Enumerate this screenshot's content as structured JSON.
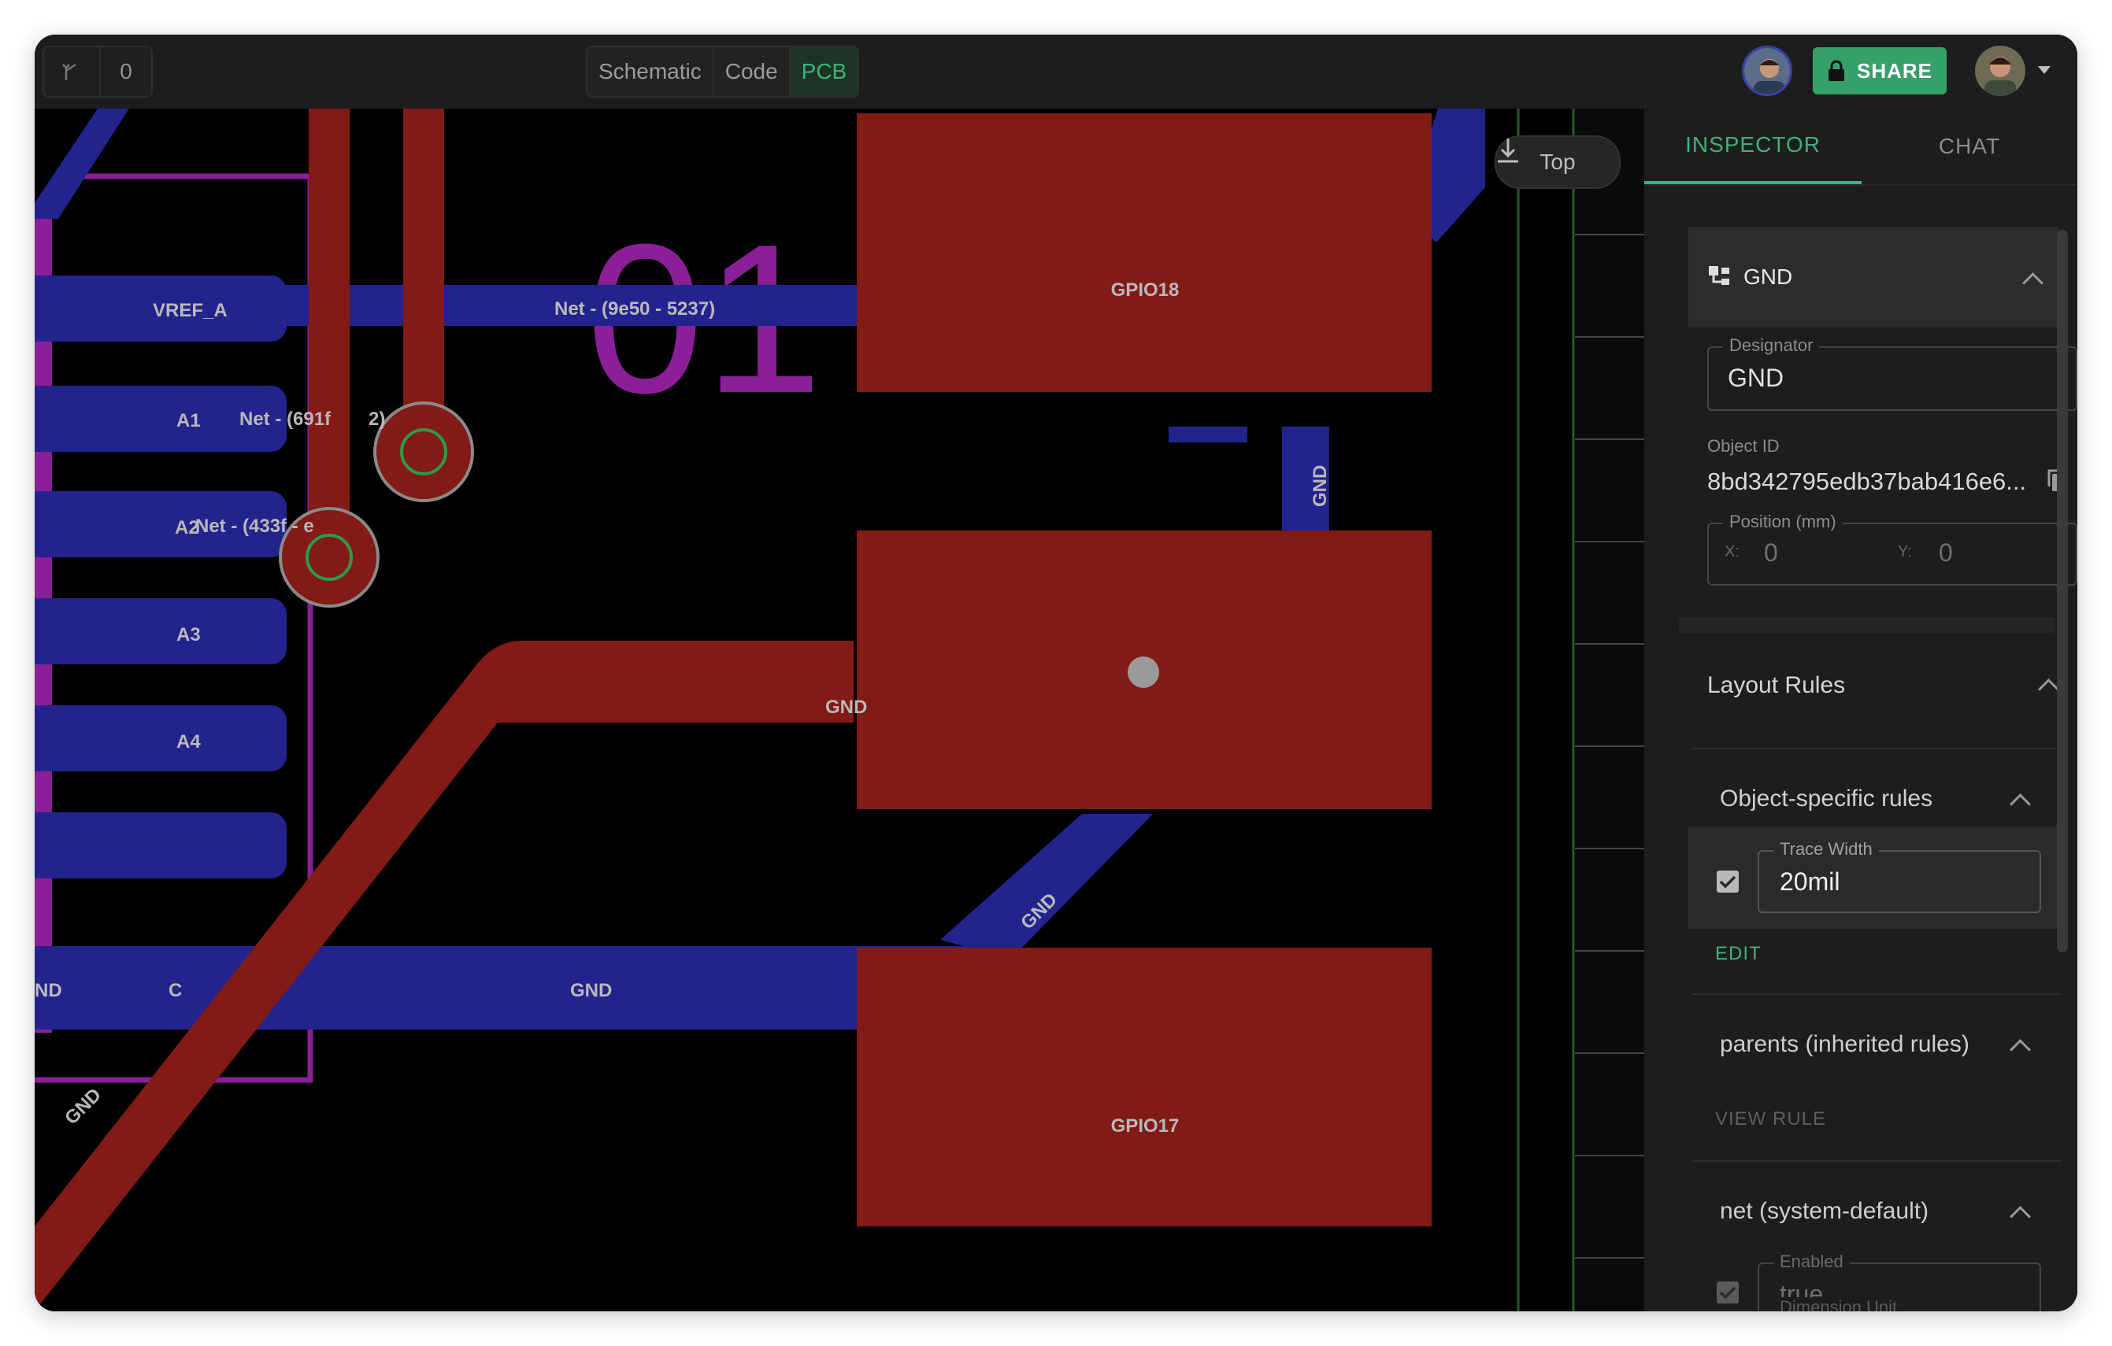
{
  "toolbar": {
    "count": "0",
    "views": [
      "Schematic",
      "Code",
      "PCB"
    ],
    "active_view": "PCB",
    "share_label": "SHARE"
  },
  "canvas": {
    "layer_label": "Top",
    "big_text": "01",
    "pads": [
      "GPIO18",
      "GPIO17"
    ],
    "pin_labels": [
      "VREF_A",
      "A1",
      "A2",
      "A3",
      "A4"
    ],
    "net_labels": {
      "net_a": "Net - (9e50 - 5237)",
      "net_b": "Net - (691f",
      "net_b_tail": "2)",
      "net_c": "Net - (433f - e",
      "gnd": "GND",
      "gnd_partial": "ND",
      "c_partial": "C"
    }
  },
  "panel": {
    "tabs": [
      "INSPECTOR",
      "CHAT"
    ],
    "object_name": "GND",
    "designator_label": "Designator",
    "designator_value": "GND",
    "object_id_label": "Object ID",
    "object_id_value": "8bd342795edb37bab416e6...",
    "position_label": "Position (mm)",
    "x_label": "X:",
    "x_value": "0",
    "y_label": "Y:",
    "y_value": "0",
    "layout_rules_title": "Layout Rules",
    "object_rules_title": "Object-specific rules",
    "trace_width_label": "Trace Width",
    "trace_width_value": "20mil",
    "edit_label": "EDIT",
    "parents_title": "parents (inherited rules)",
    "view_rule_label": "VIEW RULE",
    "net_title": "net (system-default)",
    "enabled_label": "Enabled",
    "enabled_value": "true",
    "dimension_unit_label": "Dimension Unit"
  },
  "colors": {
    "accent": "#3cb37a",
    "copper_top": "#821a16",
    "copper_bottom": "#23238e",
    "silkscreen": "#8a1f97"
  }
}
